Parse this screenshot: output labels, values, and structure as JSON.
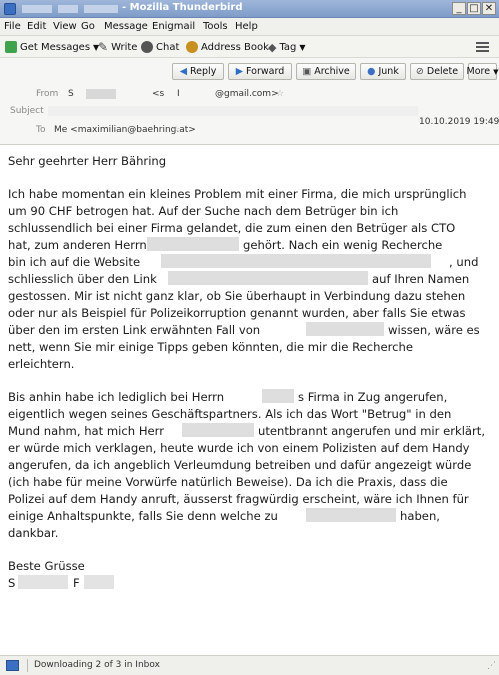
{
  "window": {
    "title": "- Mozilla Thunderbird"
  },
  "menu": [
    "File",
    "Edit",
    "View",
    "Go",
    "Message",
    "Enigmail",
    "Tools",
    "Help"
  ],
  "toolbar": {
    "get_messages": "Get Messages",
    "write": "Write",
    "chat": "Chat",
    "address_book": "Address Book",
    "tag": "Tag"
  },
  "actions": {
    "reply": "Reply",
    "forward": "Forward",
    "archive": "Archive",
    "junk": "Junk",
    "delete": "Delete",
    "more": "More"
  },
  "header": {
    "from_label": "From",
    "from_value": "S",
    "from_email_start": "<s",
    "from_email_end": "@gmail.com>",
    "subject_label": "Subject",
    "date": "10.10.2019 19:49",
    "to_label": "To",
    "to_value": "Me <maximilian@baehring.at>"
  },
  "message": {
    "greeting": "Sehr geehrter Herr Bähring",
    "p1": [
      "Ich habe momentan ein kleines Problem mit einer Firma, die mich ursprünglich",
      "um 90 CHF betrogen hat. Auf der Suche nach dem Betrüger bin ich",
      "schlussendlich bei einer Firma gelandet, die zum einen den Betrüger als CTO",
      "hat, zum anderen Herrn",
      "gehört. Nach ein wenig Recherche",
      "bin ich auf die Website",
      ", und",
      "schliesslich über den Link",
      "auf Ihren Namen",
      "gestossen. Mir ist nicht ganz klar, ob Sie überhaupt in Verbindung dazu stehen",
      "oder nur als Beispiel für Polizeikorruption genannt wurden, aber falls Sie etwas",
      "über den im ersten Link erwähnten Fall von",
      "wissen, wäre es",
      "nett, wenn Sie mir einige Tipps geben könnten, die mir die Recherche",
      "erleichtern."
    ],
    "p2": [
      "Bis anhin habe ich lediglich bei Herrn",
      "s Firma in Zug angerufen,",
      "eigentlich wegen seines Geschäftspartners. Als ich das Wort \"Betrug\" in den",
      "Mund nahm, hat mich Herr",
      "utentbrannt angerufen und mir erklärt,",
      "er würde mich verklagen, heute wurde ich von einem Polizisten auf dem Handy",
      "angerufen, da ich angeblich Verleumdung betreiben und dafür angezeigt würde",
      "(ich habe für meine Vorwürfe natürlich Beweise). Da ich die Praxis, dass die",
      "Polizei auf dem Handy anruft, äusserst fragwürdig erscheint, wäre ich Ihnen für",
      "einige Anhaltspunkte, falls Sie denn welche zu",
      "haben,",
      "dankbar."
    ],
    "closing": "Beste Grüsse",
    "sig_s": "S",
    "sig_f": "F"
  },
  "status": {
    "text": "Downloading 2 of 3 in Inbox"
  }
}
